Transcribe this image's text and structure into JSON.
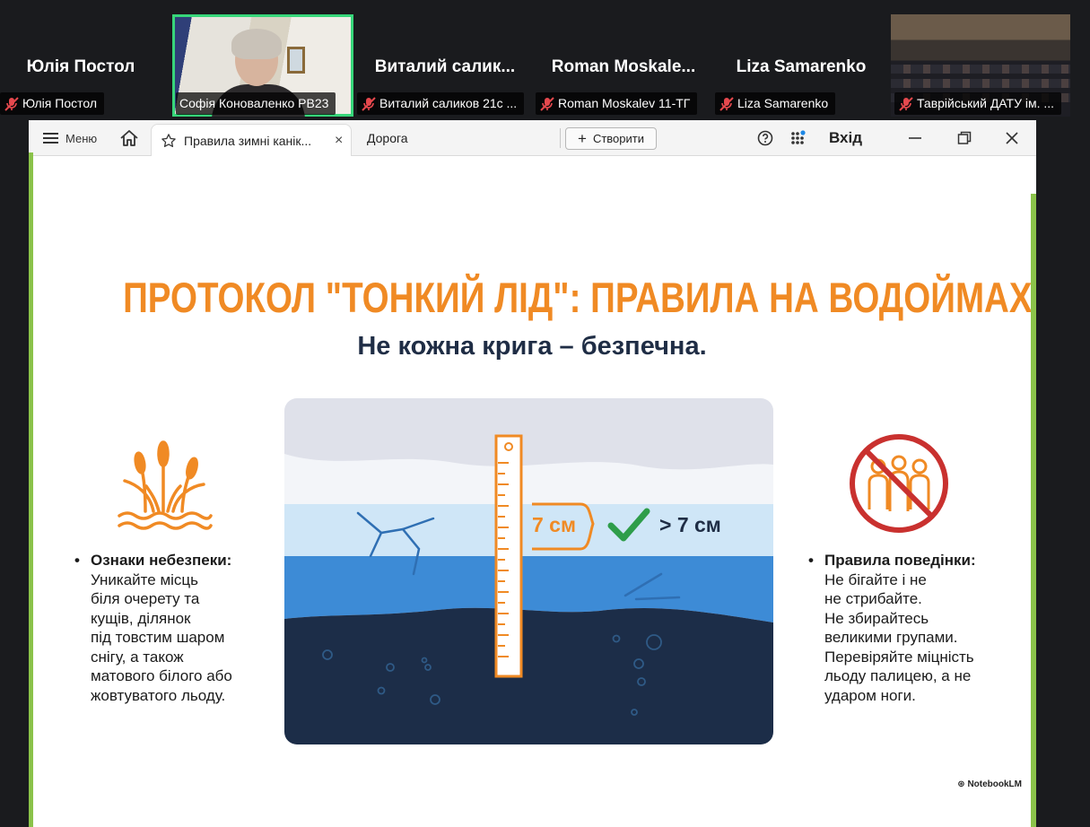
{
  "participants": [
    {
      "big_name": "Юлія Постол",
      "label": "Юлія Постол"
    },
    {
      "big_name": "",
      "label": "Софія Коноваленко РВ23"
    },
    {
      "big_name": "Виталий салик...",
      "label": "Виталий саликов 21с ..."
    },
    {
      "big_name": "Roman Moskale...",
      "label": "Roman Moskalev 11-ТГ"
    },
    {
      "big_name": "Liza Samarenko",
      "label": "Liza Samarenko"
    },
    {
      "big_name": "",
      "label": "Таврійський ДАТУ ім. ..."
    }
  ],
  "toolbar": {
    "menu_label": "Меню",
    "tab_title": "Правила зимні канік...",
    "tab_close": "×",
    "tab2_title": "Дорога",
    "create_label": "Створити",
    "login_label": "Вхід"
  },
  "slide": {
    "title": "ПРОТОКОЛ \"ТОНКИЙ ЛІД\": ПРАВИЛА НА ВОДОЙМАХ",
    "subtitle": "Не кожна крига – безпечна.",
    "ruler_label": "7 см",
    "check_label": "> 7 см",
    "left_head": "Ознаки небезпеки:",
    "left_lines": [
      "Уникайте місць",
      "біля очерету та",
      "кущів, ділянок",
      "під товстим шаром",
      "снігу, а також",
      "матового білого або",
      "жовтуватого льоду."
    ],
    "right_head": "Правила поведінки:",
    "right_lines": [
      "Не бігайте і не",
      "не стрибайте.",
      "Не збирайтесь",
      "великими групами.",
      "Перевіряйте міцність",
      "льоду палицею, а не",
      "ударом ноги."
    ],
    "watermark": "NotebookLM"
  },
  "colors": {
    "accent_orange": "#f08a24",
    "title_dark": "#1f2d45",
    "active_speaker": "#37d67a",
    "slide_border_green": "#8bc34a",
    "prohibition_red": "#c9312f"
  }
}
